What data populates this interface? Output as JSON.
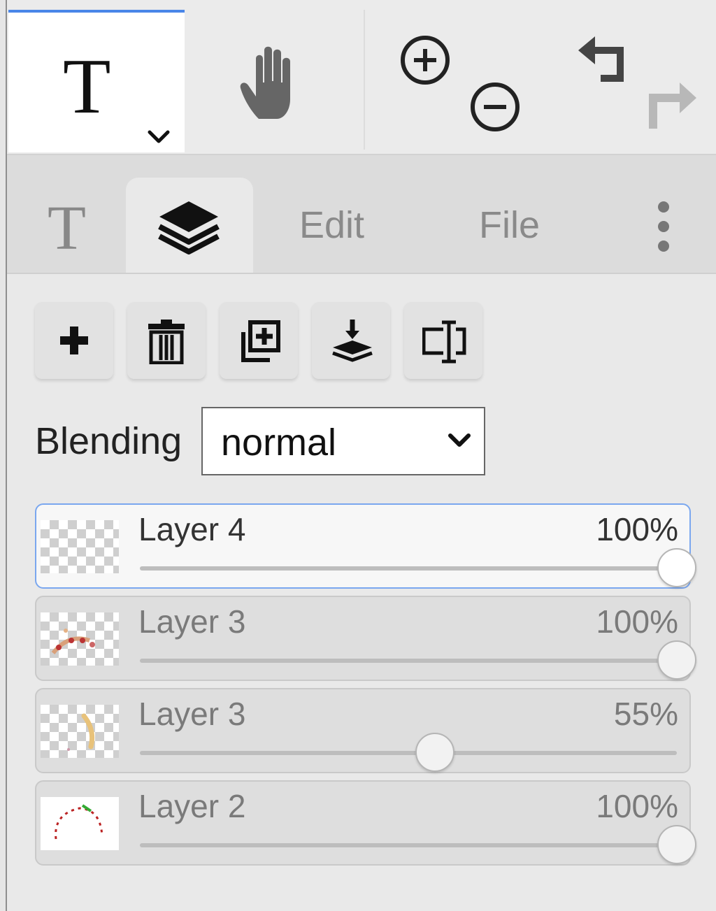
{
  "toolbar": {
    "tools": [
      {
        "name": "text-tool",
        "icon": "text-T-icon",
        "active": true
      },
      {
        "name": "hand-tool",
        "icon": "hand-icon",
        "active": false
      }
    ],
    "actions": [
      "zoom-in-icon",
      "zoom-out-icon",
      "undo-icon",
      "redo-icon"
    ],
    "accent_color": "#4a86e8"
  },
  "tabs": {
    "items": [
      {
        "id": "text",
        "icon": "text-T-icon"
      },
      {
        "id": "layers",
        "icon": "layers-icon",
        "active": true
      },
      {
        "id": "edit",
        "label": "Edit"
      },
      {
        "id": "file",
        "label": "File"
      }
    ],
    "more_icon": "vertical-dots-icon"
  },
  "layer_actions": [
    "add-layer-icon",
    "delete-layer-icon",
    "duplicate-layer-icon",
    "merge-down-icon",
    "rename-layer-icon"
  ],
  "blending": {
    "label": "Blending",
    "value": "normal"
  },
  "layers": [
    {
      "name": "Layer 4",
      "opacity_label": "100%",
      "opacity": 100,
      "selected": true,
      "thumbnail": "transparent"
    },
    {
      "name": "Layer 3",
      "opacity_label": "100%",
      "opacity": 100,
      "selected": false,
      "thumbnail": "red-dots"
    },
    {
      "name": "Layer 3",
      "opacity_label": "55%",
      "opacity": 55,
      "selected": false,
      "thumbnail": "yellow-stroke"
    },
    {
      "name": "Layer 2",
      "opacity_label": "100%",
      "opacity": 100,
      "selected": false,
      "thumbnail": "dotted-arc"
    }
  ]
}
